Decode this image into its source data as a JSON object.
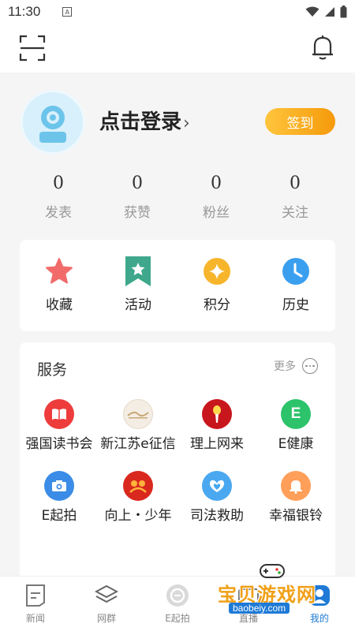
{
  "status_bar": {
    "time": "11:30"
  },
  "profile": {
    "login_label": "点击登录",
    "chevron": "›",
    "checkin_label": "签到",
    "stats": [
      {
        "value": "0",
        "label": "发表"
      },
      {
        "value": "0",
        "label": "获赞"
      },
      {
        "value": "0",
        "label": "粉丝"
      },
      {
        "value": "0",
        "label": "关注"
      }
    ]
  },
  "quick_actions": [
    {
      "label": "收藏",
      "icon": "star-icon"
    },
    {
      "label": "活动",
      "icon": "bookmark-star-icon"
    },
    {
      "label": "积分",
      "icon": "points-diamond-icon"
    },
    {
      "label": "历史",
      "icon": "clock-icon"
    }
  ],
  "services": {
    "title": "服务",
    "more_label": "更多",
    "items": [
      {
        "label": "强国读书会",
        "icon": "book-icon",
        "color": "#ee3c3c"
      },
      {
        "label": "新江苏e征信",
        "icon": "credit-logo-icon",
        "color": "#f3ede4"
      },
      {
        "label": "理上网来",
        "icon": "torch-icon",
        "color": "#c8161d"
      },
      {
        "label": "E健康",
        "icon": "e-health-icon",
        "color": "#2cc36b"
      },
      {
        "label": "E起拍",
        "icon": "camera-icon",
        "color": "#3b8ce6"
      },
      {
        "label": "向上・少年",
        "icon": "youth-icon",
        "color": "#d9281e"
      },
      {
        "label": "司法救助",
        "icon": "heart-hands-icon",
        "color": "#4aa8f0"
      },
      {
        "label": "幸福银铃",
        "icon": "bell-icon",
        "color": "#ff9f5a"
      }
    ]
  },
  "tabbar": [
    {
      "label": "新闻",
      "icon": "news-icon"
    },
    {
      "label": "网群",
      "icon": "layers-icon"
    },
    {
      "label": "E起拍",
      "icon": "e-camera-icon"
    },
    {
      "label": "直播",
      "icon": "live-icon"
    },
    {
      "label": "我的",
      "icon": "profile-icon"
    }
  ],
  "watermark": {
    "text": "宝贝游戏网",
    "url": "baobeiy.com"
  },
  "colors": {
    "accent_orange": "#f59a0b",
    "brand_blue": "#1e7ad6",
    "background": "#f5f5f5"
  }
}
